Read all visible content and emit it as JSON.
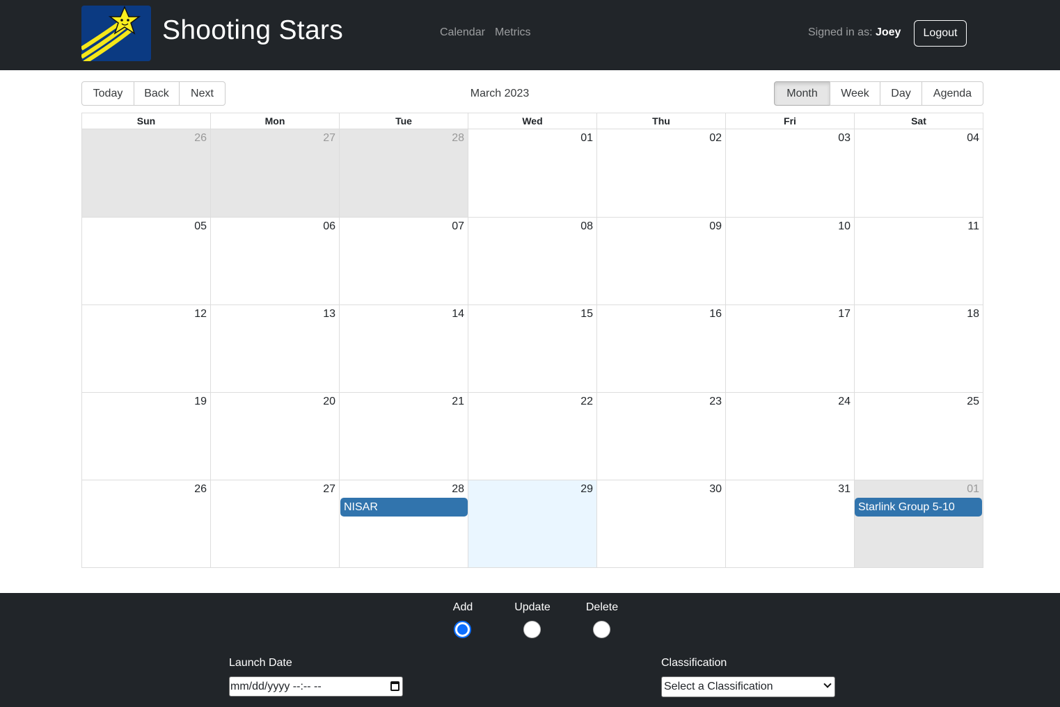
{
  "app": {
    "title": "Shooting Stars",
    "logo_icon": "shooting-star-logo"
  },
  "nav": {
    "links": [
      "Calendar",
      "Metrics"
    ]
  },
  "user": {
    "signed_in_label": "Signed in as:",
    "name": "Joey",
    "logout_label": "Logout"
  },
  "toolbar": {
    "nav_buttons": [
      "Today",
      "Back",
      "Next"
    ],
    "label": "March 2023",
    "views": [
      "Month",
      "Week",
      "Day",
      "Agenda"
    ],
    "active_view": "Month"
  },
  "calendar": {
    "weekdays": [
      "Sun",
      "Mon",
      "Tue",
      "Wed",
      "Thu",
      "Fri",
      "Sat"
    ],
    "weeks": [
      [
        "26",
        "27",
        "28",
        "01",
        "02",
        "03",
        "04"
      ],
      [
        "05",
        "06",
        "07",
        "08",
        "09",
        "10",
        "11"
      ],
      [
        "12",
        "13",
        "14",
        "15",
        "16",
        "17",
        "18"
      ],
      [
        "19",
        "20",
        "21",
        "22",
        "23",
        "24",
        "25"
      ],
      [
        "26",
        "27",
        "28",
        "29",
        "30",
        "31",
        "01"
      ]
    ],
    "events": [
      {
        "title": "NISAR",
        "date": "2023-03-28"
      },
      {
        "title": "Starlink Group 5-10",
        "date": "2023-04-01"
      }
    ],
    "colors": {
      "event": "#3174ad",
      "off_range": "#e6e6e6",
      "today": "#eaf6ff"
    }
  },
  "form": {
    "actions": [
      "Add",
      "Update",
      "Delete"
    ],
    "selected_action": "Add",
    "launch_date_label": "Launch Date",
    "launch_date_placeholder": "mm/dd/yyyy --:-- --",
    "classification_label": "Classification",
    "classification_value": "Select a Classification"
  }
}
